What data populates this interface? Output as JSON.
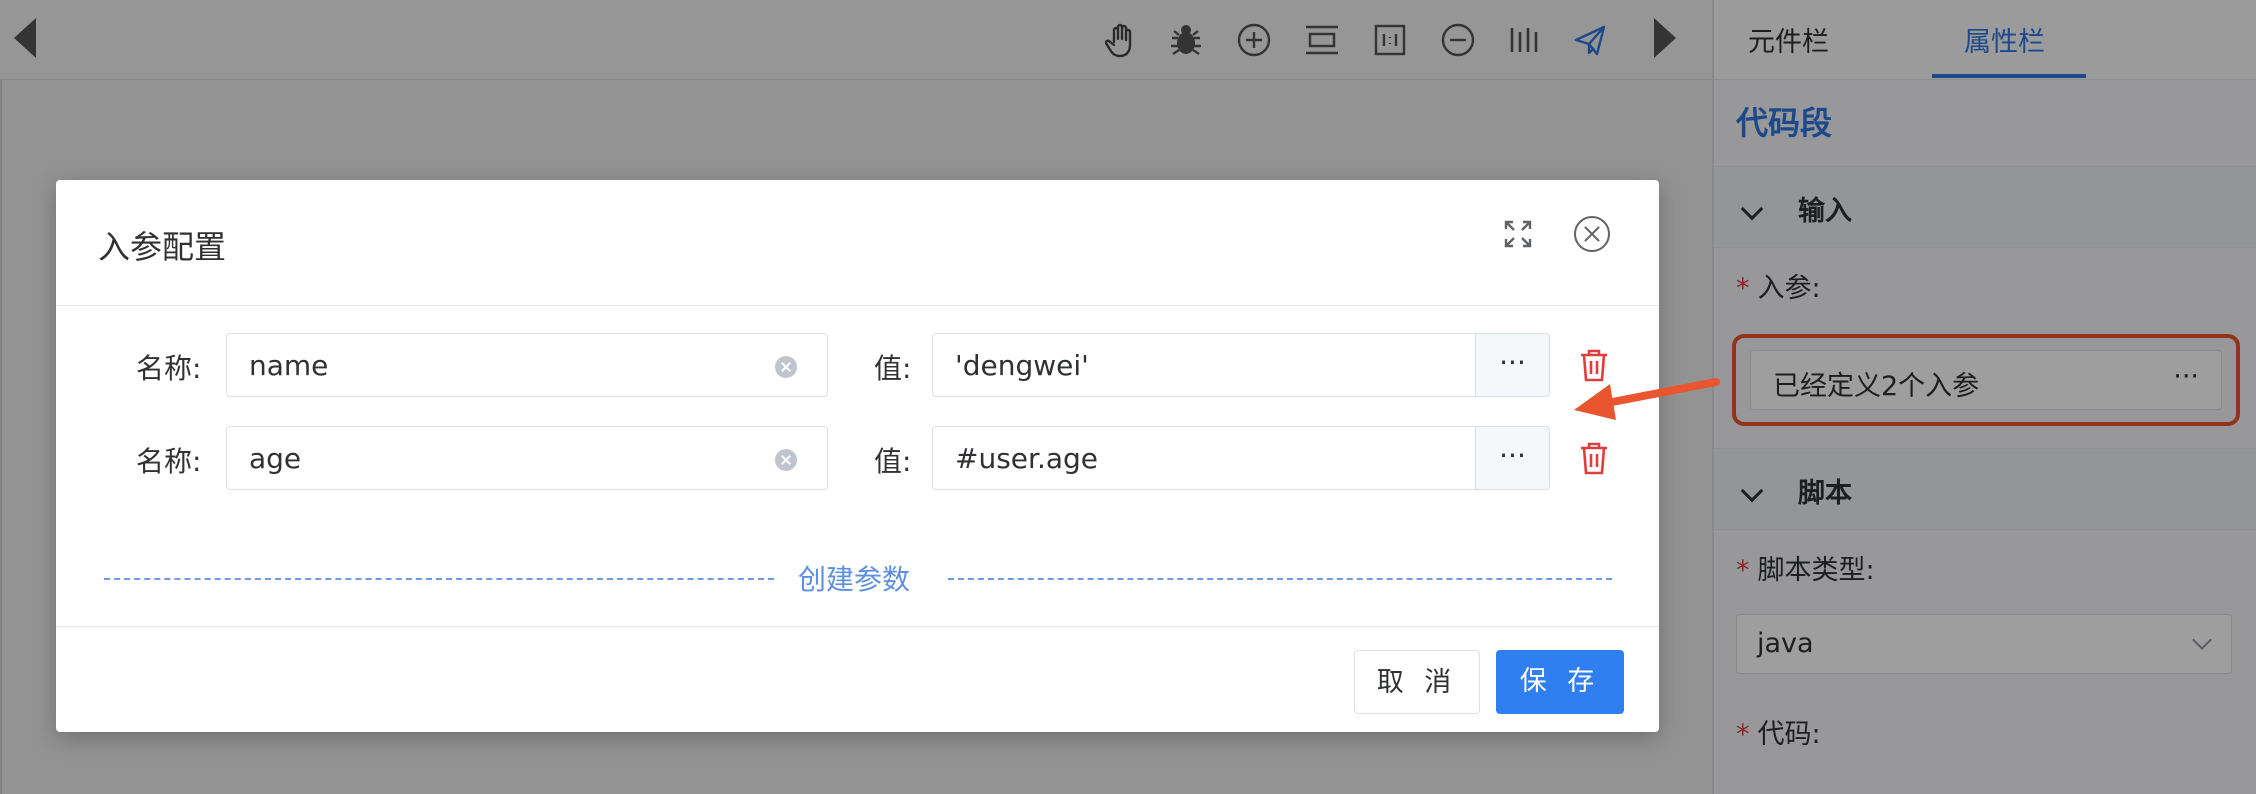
{
  "toolbar": {
    "icons": [
      "hand-icon",
      "bug-icon",
      "zoom-in-icon",
      "fit-height-icon",
      "actual-size-icon",
      "zoom-out-icon",
      "align-icon",
      "send-icon"
    ]
  },
  "right_panel": {
    "tabs": [
      {
        "label": "元件栏",
        "active": false
      },
      {
        "label": "属性栏",
        "active": true
      }
    ],
    "title": "代码段",
    "sections": {
      "input": {
        "label": "输入"
      },
      "script": {
        "label": "脚本"
      }
    },
    "param_label": "入参:",
    "param_value": "已经定义2个入参",
    "param_dots": "···",
    "script_type_label": "脚本类型:",
    "script_type_value": "java",
    "code_label": "代码:",
    "required_mark": "*"
  },
  "dialog": {
    "title": "入参配置",
    "rows": [
      {
        "name_label": "名称:",
        "name_value": "name",
        "value_label": "值:",
        "value_value": "'dengwei'",
        "more": "···"
      },
      {
        "name_label": "名称:",
        "name_value": "age",
        "value_label": "值:",
        "value_value": "#user.age",
        "more": "···"
      }
    ],
    "create_label": "创建参数",
    "cancel_label": "取 消",
    "save_label": "保 存"
  },
  "colors": {
    "accent": "#2f7ff0",
    "danger": "#e23d3d",
    "highlight": "#e8552e"
  }
}
